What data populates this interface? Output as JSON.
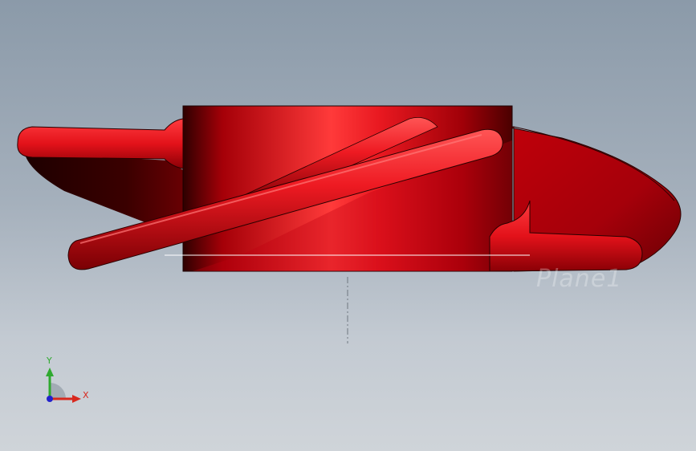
{
  "viewport": {
    "name": "3d-model-viewport",
    "plane_label": "Plane1",
    "background_top": "#8b9aa9",
    "background_bottom": "#cfd4d9"
  },
  "model": {
    "name": "impeller-part",
    "color": "#e8141c",
    "shadow_color": "#2a0000"
  },
  "triad": {
    "x_label": "X",
    "y_label": "Y",
    "x_color": "#d8281e",
    "y_color": "#2fa92f",
    "z_color": "#2222cc"
  }
}
